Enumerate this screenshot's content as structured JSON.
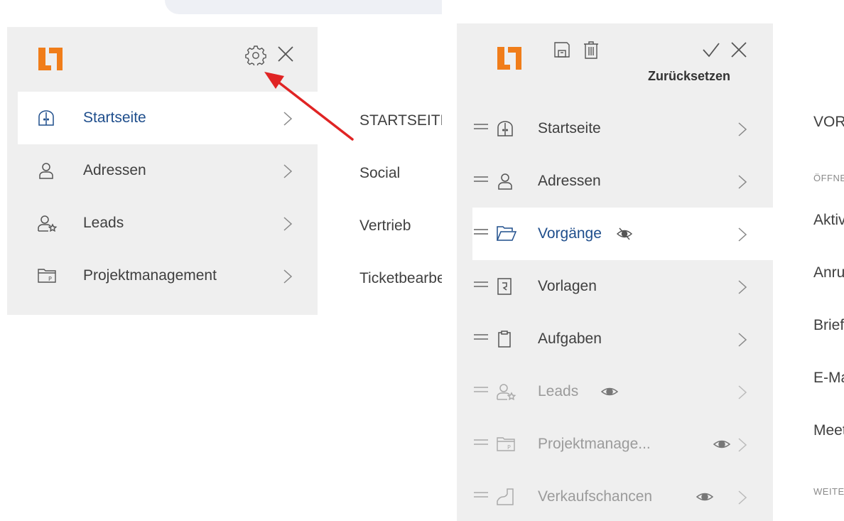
{
  "colors": {
    "brand_orange": "#f07d1a",
    "active_text": "#1f4e8c",
    "panel_bg": "#efefef",
    "arrow_red": "#e02424",
    "dim_text": "#9b9b9b"
  },
  "left_menu": {
    "header_icons": [
      "app-logo",
      "gear-icon",
      "close-icon"
    ],
    "items": [
      {
        "label": "Startseite",
        "icon": "home-door-icon",
        "active": true
      },
      {
        "label": "Adressen",
        "icon": "person-icon",
        "active": false
      },
      {
        "label": "Leads",
        "icon": "person-star-icon",
        "active": false
      },
      {
        "label": "Projektmanagement",
        "icon": "folder-p-icon",
        "active": false
      }
    ]
  },
  "left_submenu": {
    "items": [
      "STARTSEITE",
      "Social",
      "Vertrieb",
      "Ticketbearbeitung"
    ]
  },
  "edit_menu": {
    "header_icons": [
      "app-logo",
      "save-icon",
      "trash-icon",
      "checkmark-icon",
      "close-icon"
    ],
    "reset_label": "Zurücksetzen",
    "items": [
      {
        "label": "Startseite",
        "icon": "home-door-icon",
        "hidden": false,
        "active": false
      },
      {
        "label": "Adressen",
        "icon": "person-icon",
        "hidden": false,
        "active": false
      },
      {
        "label": "Vorgänge",
        "icon": "folder-open-icon",
        "hidden": false,
        "active": true,
        "eye": "eye-slash-icon"
      },
      {
        "label": "Vorlagen",
        "icon": "template-icon",
        "hidden": false,
        "active": false
      },
      {
        "label": "Aufgaben",
        "icon": "clipboard-icon",
        "hidden": false,
        "active": false
      },
      {
        "label": "Leads",
        "icon": "person-star-icon",
        "hidden": true,
        "active": false,
        "eye": "eye-icon"
      },
      {
        "label": "Projektmanage...",
        "icon": "folder-p-icon",
        "hidden": true,
        "active": false,
        "eye": "eye-icon"
      },
      {
        "label": "Verkaufschancen",
        "icon": "chart-rise-icon",
        "hidden": true,
        "active": false,
        "eye": "eye-icon"
      }
    ]
  },
  "right_submenu": {
    "title": "VORGÄNGE",
    "section_open": "ÖFFNEN",
    "items": [
      "Aktivitäten",
      "Anrufe",
      "Briefe",
      "E-Mails",
      "Meetings"
    ],
    "section_more": "WEITERE"
  }
}
